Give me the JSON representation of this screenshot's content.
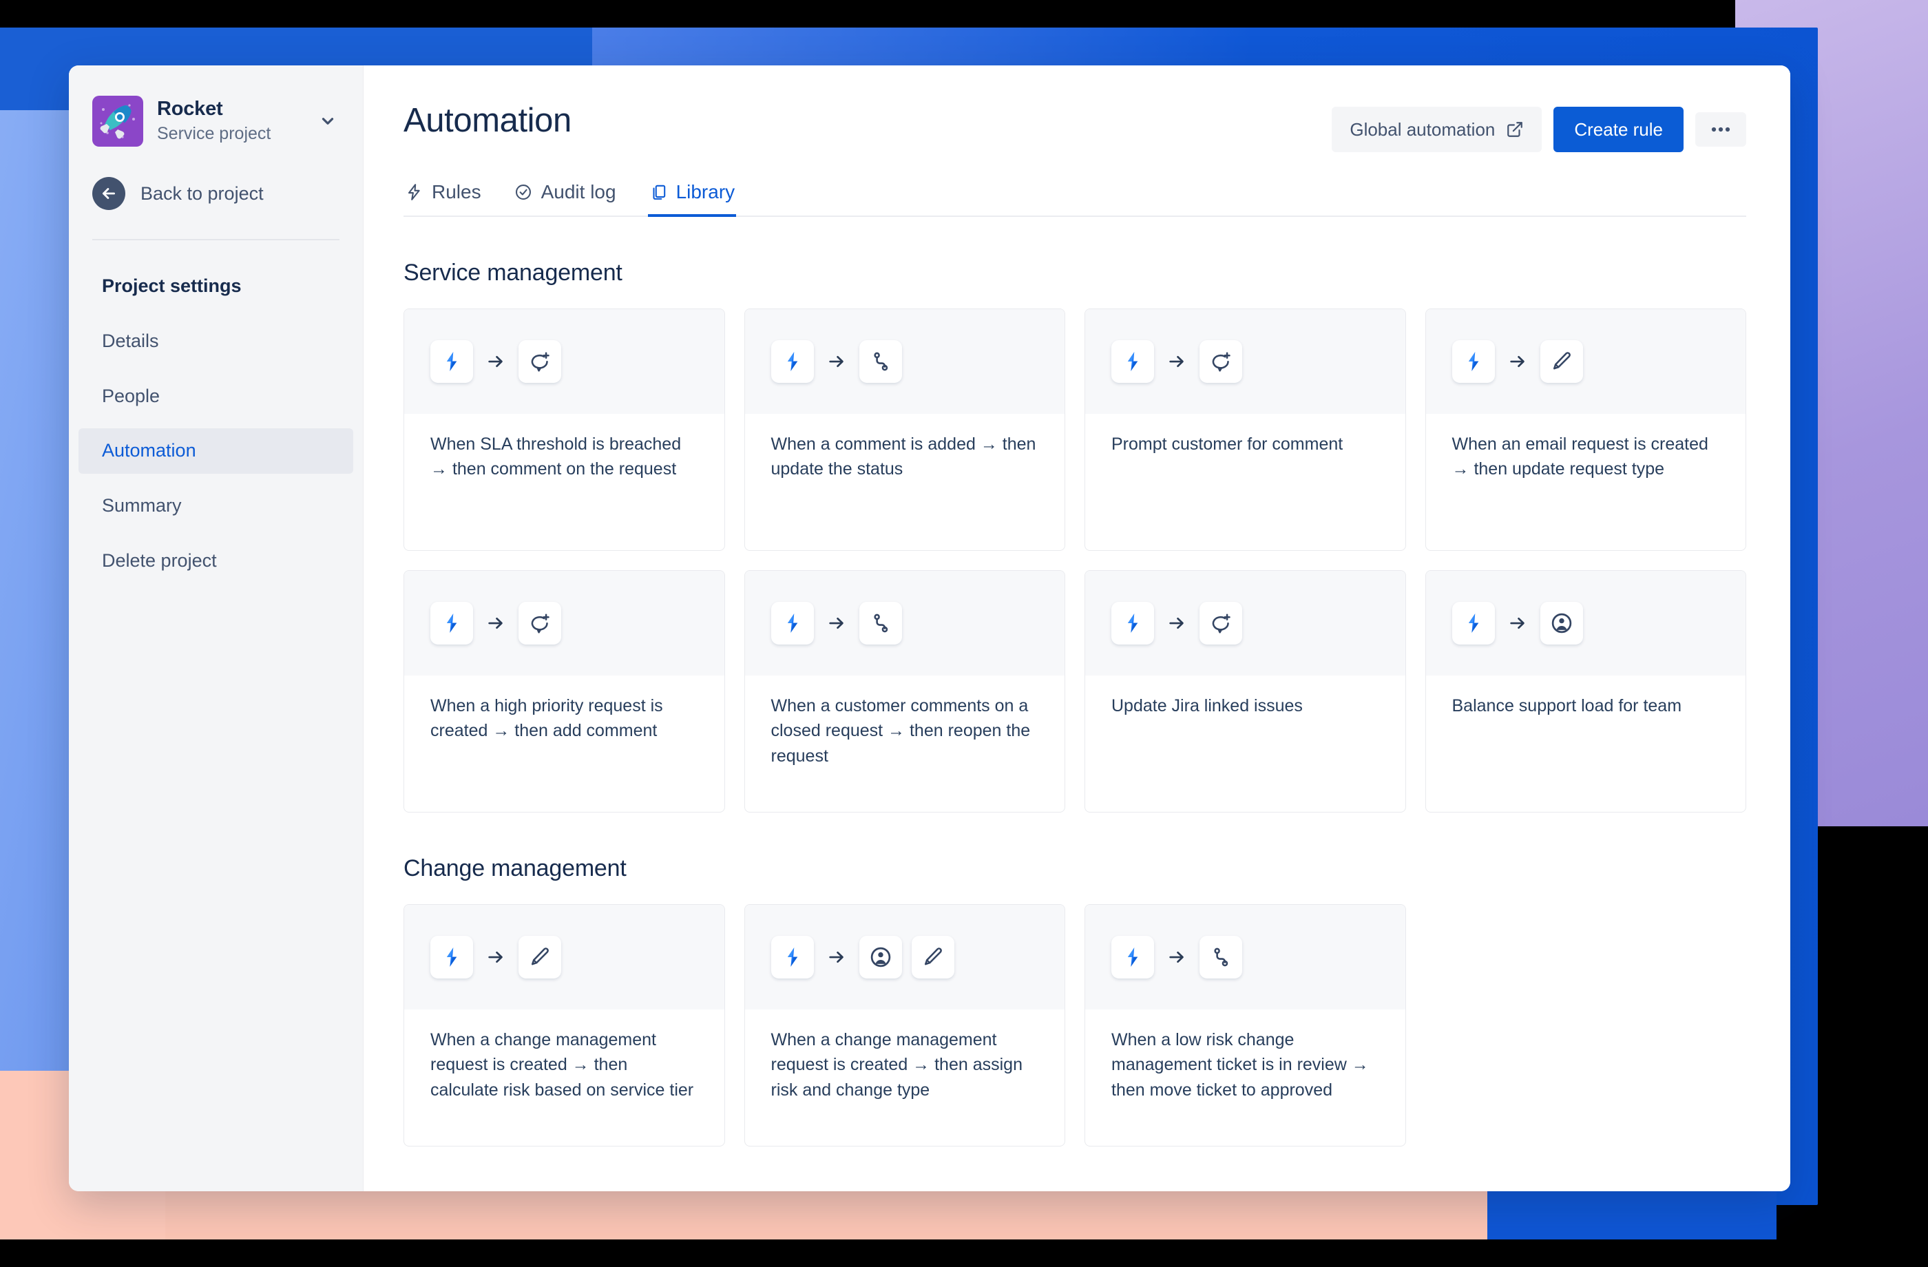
{
  "sidebar": {
    "project_name": "Rocket",
    "project_type": "Service project",
    "avatar_icon": "rocket-icon",
    "chevron_icon": "chevron-down-icon",
    "back_label": "Back to project",
    "back_icon": "arrow-left-icon",
    "items": [
      {
        "label": "Project settings",
        "heading": true,
        "active": false
      },
      {
        "label": "Details",
        "heading": false,
        "active": false
      },
      {
        "label": "People",
        "heading": false,
        "active": false
      },
      {
        "label": "Automation",
        "heading": false,
        "active": true
      },
      {
        "label": "Summary",
        "heading": false,
        "active": false
      },
      {
        "label": "Delete project",
        "heading": false,
        "active": false
      }
    ]
  },
  "header": {
    "title": "Automation",
    "global_automation_label": "Global automation",
    "global_automation_icon": "external-link-icon",
    "create_rule_label": "Create rule",
    "more_label": "•••",
    "more_icon": "more-horizontal-icon"
  },
  "tabs": [
    {
      "label": "Rules",
      "icon": "lightning-icon",
      "active": false
    },
    {
      "label": "Audit log",
      "icon": "check-circle-icon",
      "active": false
    },
    {
      "label": "Library",
      "icon": "copy-icon",
      "active": true
    }
  ],
  "sections": [
    {
      "title": "Service management",
      "cards": [
        {
          "title": "When SLA threshold is breached → then comment on the request",
          "icons": [
            "jira-trigger-icon",
            "arrow-right-icon",
            "add-comment-icon"
          ]
        },
        {
          "title": "When a comment is added → then update the status",
          "icons": [
            "jira-trigger-icon",
            "arrow-right-icon",
            "transition-icon"
          ]
        },
        {
          "title": "Prompt customer for comment",
          "icons": [
            "jira-trigger-icon",
            "arrow-right-icon",
            "add-comment-icon"
          ]
        },
        {
          "title": "When an email request is created → then update request type",
          "icons": [
            "jira-trigger-icon",
            "arrow-right-icon",
            "edit-icon"
          ]
        },
        {
          "title": "When a high priority request is created → then add comment",
          "icons": [
            "jira-trigger-icon",
            "arrow-right-icon",
            "add-comment-icon"
          ]
        },
        {
          "title": "When a customer comments on a closed request → then reopen the request",
          "icons": [
            "jira-trigger-icon",
            "arrow-right-icon",
            "transition-icon"
          ]
        },
        {
          "title": "Update Jira linked issues",
          "icons": [
            "jira-trigger-icon",
            "arrow-right-icon",
            "add-comment-icon"
          ]
        },
        {
          "title": "Balance support load for team",
          "icons": [
            "jira-trigger-icon",
            "arrow-right-icon",
            "assignee-icon"
          ]
        }
      ]
    },
    {
      "title": "Change management",
      "cards": [
        {
          "title": "When a change management request is created → then calculate risk based on service tier",
          "icons": [
            "jira-trigger-icon",
            "arrow-right-icon",
            "edit-icon"
          ]
        },
        {
          "title": "When a change management request is created → then assign risk and change type",
          "icons": [
            "jira-trigger-icon",
            "arrow-right-icon",
            "assignee-icon",
            "edit-icon"
          ]
        },
        {
          "title": "When a low risk change management ticket is in review → then move ticket to approved",
          "icons": [
            "jira-trigger-icon",
            "arrow-right-icon",
            "transition-icon"
          ]
        }
      ]
    }
  ],
  "colors": {
    "accent": "#0c5bd6",
    "primary_button": "#0b5cd5",
    "text": "#172b4d",
    "muted_text": "#42526e",
    "avatar_bg": "#8b46c8"
  }
}
